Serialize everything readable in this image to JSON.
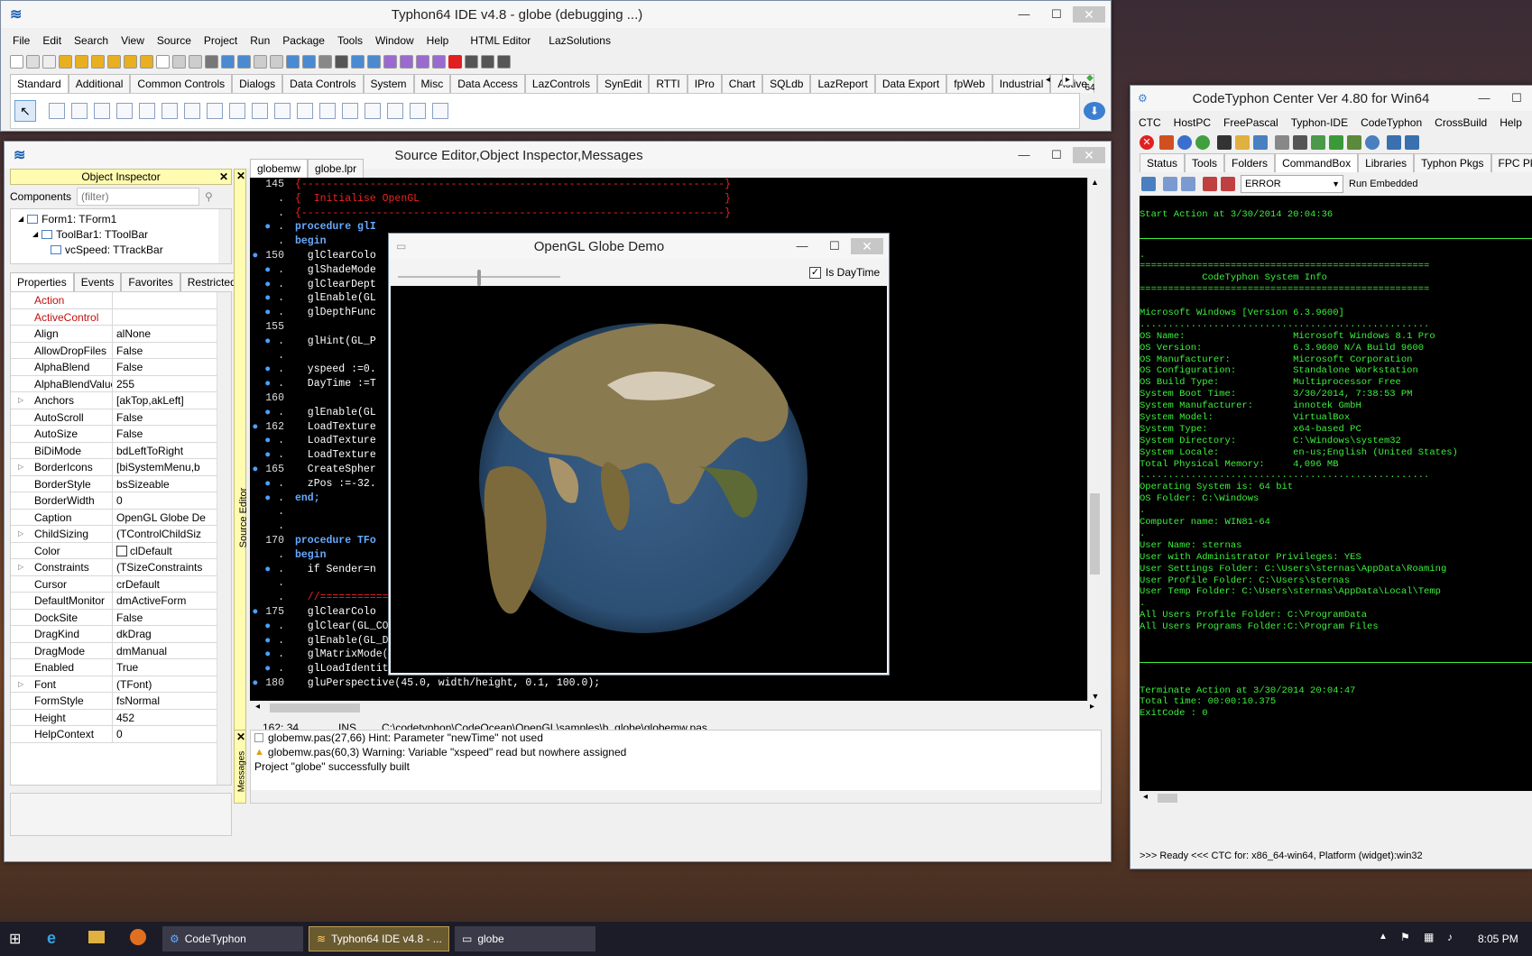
{
  "ide_main": {
    "title": "Typhon64 IDE v4.8 - globe (debugging ...)",
    "menu": [
      "File",
      "Edit",
      "Search",
      "View",
      "Source",
      "Project",
      "Run",
      "Package",
      "Tools",
      "Window",
      "Help",
      "HTML Editor",
      "LazSolutions"
    ],
    "palette_tabs": [
      "Standard",
      "Additional",
      "Common Controls",
      "Dialogs",
      "Data Controls",
      "System",
      "Misc",
      "Data Access",
      "LazControls",
      "SynEdit",
      "RTTI",
      "IPro",
      "Chart",
      "SQLdb",
      "LazReport",
      "Data Export",
      "fpWeb",
      "Industrial",
      "Active"
    ],
    "bitness": "64"
  },
  "source_window": {
    "title": "Source Editor,Object Inspector,Messages"
  },
  "object_inspector": {
    "title": "Object Inspector",
    "components_label": "Components",
    "filter_placeholder": "(filter)",
    "tree": [
      "Form1: TForm1",
      "ToolBar1: TToolBar",
      "vcSpeed: TTrackBar"
    ],
    "tabs": [
      "Properties",
      "Events",
      "Favorites",
      "Restricted"
    ],
    "props": [
      {
        "name": "Action",
        "value": "",
        "style": "red"
      },
      {
        "name": "ActiveControl",
        "value": "",
        "style": "red"
      },
      {
        "name": "Align",
        "value": "alNone"
      },
      {
        "name": "AllowDropFiles",
        "value": "False"
      },
      {
        "name": "AlphaBlend",
        "value": "False"
      },
      {
        "name": "AlphaBlendValue",
        "value": "255"
      },
      {
        "name": "Anchors",
        "value": "[akTop,akLeft]",
        "expand": true
      },
      {
        "name": "AutoScroll",
        "value": "False"
      },
      {
        "name": "AutoSize",
        "value": "False"
      },
      {
        "name": "BiDiMode",
        "value": "bdLeftToRight"
      },
      {
        "name": "BorderIcons",
        "value": "[biSystemMenu,b",
        "expand": true
      },
      {
        "name": "BorderStyle",
        "value": "bsSizeable"
      },
      {
        "name": "BorderWidth",
        "value": "0"
      },
      {
        "name": "Caption",
        "value": "OpenGL Globe De"
      },
      {
        "name": "ChildSizing",
        "value": "(TControlChildSiz",
        "expand": true
      },
      {
        "name": "Color",
        "value": "clDefault",
        "swatch": true
      },
      {
        "name": "Constraints",
        "value": "(TSizeConstraints",
        "expand": true
      },
      {
        "name": "Cursor",
        "value": "crDefault"
      },
      {
        "name": "DefaultMonitor",
        "value": "dmActiveForm"
      },
      {
        "name": "DockSite",
        "value": "False"
      },
      {
        "name": "DragKind",
        "value": "dkDrag"
      },
      {
        "name": "DragMode",
        "value": "dmManual"
      },
      {
        "name": "Enabled",
        "value": "True"
      },
      {
        "name": "Font",
        "value": "(TFont)",
        "expand": true
      },
      {
        "name": "FormStyle",
        "value": "fsNormal"
      },
      {
        "name": "Height",
        "value": "452"
      },
      {
        "name": "HelpContext",
        "value": "0"
      }
    ]
  },
  "editor": {
    "tabs": [
      "globemw",
      "globe.lpr"
    ],
    "side_label": "Source Editor",
    "lines": [
      {
        "n": "145",
        "dot": false,
        "text": "{--------------------------------------------------------------------}",
        "c": "#e22"
      },
      {
        "n": ".",
        "dot": false,
        "text": "{  Initialise OpenGL                                                 }",
        "c": "#e22"
      },
      {
        "n": ".",
        "dot": false,
        "text": "{--------------------------------------------------------------------}",
        "c": "#e22"
      },
      {
        "n": ".",
        "dot": true,
        "text": "procedure glI",
        "c": "#6af",
        "bold": true
      },
      {
        "n": ".",
        "dot": false,
        "text": "begin",
        "c": "#6af",
        "bold": true
      },
      {
        "n": "150",
        "dot": true,
        "text": "  glClearColo",
        "c": "#fff"
      },
      {
        "n": ".",
        "dot": true,
        "text": "  glShadeMode",
        "c": "#fff"
      },
      {
        "n": ".",
        "dot": true,
        "text": "  glClearDept",
        "c": "#fff"
      },
      {
        "n": ".",
        "dot": true,
        "text": "  glEnable(GL",
        "c": "#fff"
      },
      {
        "n": ".",
        "dot": true,
        "text": "  glDepthFunc",
        "c": "#fff"
      },
      {
        "n": "155",
        "dot": false,
        "text": "",
        "c": "#fff"
      },
      {
        "n": ".",
        "dot": true,
        "text": "  glHint(GL_P",
        "c": "#fff"
      },
      {
        "n": ".",
        "dot": false,
        "text": "",
        "c": "#fff"
      },
      {
        "n": ".",
        "dot": true,
        "text": "  yspeed :=0.",
        "c": "#fff"
      },
      {
        "n": ".",
        "dot": true,
        "text": "  DayTime :=T",
        "c": "#fff"
      },
      {
        "n": "160",
        "dot": false,
        "text": "",
        "c": "#fff"
      },
      {
        "n": ".",
        "dot": true,
        "text": "  glEnable(GL",
        "c": "#fff"
      },
      {
        "n": "162",
        "dot": true,
        "text": "  LoadTexture",
        "c": "#fff"
      },
      {
        "n": ".",
        "dot": true,
        "text": "  LoadTexture",
        "c": "#fff"
      },
      {
        "n": ".",
        "dot": true,
        "text": "  LoadTexture",
        "c": "#fff"
      },
      {
        "n": "165",
        "dot": true,
        "text": "  CreateSpher",
        "c": "#fff"
      },
      {
        "n": ".",
        "dot": true,
        "text": "  zPos :=-32.",
        "c": "#fff"
      },
      {
        "n": ".",
        "dot": true,
        "text": "end;",
        "c": "#6af",
        "bold": true
      },
      {
        "n": ".",
        "dot": false,
        "text": "",
        "c": "#fff"
      },
      {
        "n": ".",
        "dot": false,
        "text": "",
        "c": "#fff"
      },
      {
        "n": "170",
        "dot": false,
        "text": "procedure TFo",
        "c": "#6af",
        "bold": true
      },
      {
        "n": ".",
        "dot": false,
        "text": "begin",
        "c": "#6af",
        "bold": true
      },
      {
        "n": ".",
        "dot": true,
        "text": "  if Sender=n",
        "c": "#fff"
      },
      {
        "n": ".",
        "dot": false,
        "text": "",
        "c": "#fff"
      },
      {
        "n": ".",
        "dot": false,
        "text": "  //===========                                                                    =========",
        "c": "#e22"
      },
      {
        "n": "175",
        "dot": true,
        "text": "  glClearColo                                                                    cene",
        "c": "#fff"
      },
      {
        "n": ".",
        "dot": true,
        "text": "  glClear(GL_COLOR_BUFFER_BIT or GL_DEPTH_BUFFER_BIT);   // Clear the colour buffer",
        "c": "#fff"
      },
      {
        "n": ".",
        "dot": true,
        "text": "  glEnable(GL_DEPTH_TEST);",
        "c": "#fff"
      },
      {
        "n": ".",
        "dot": true,
        "text": "  glMatrixMode(GL_PROJECTION);",
        "c": "#fff"
      },
      {
        "n": ".",
        "dot": true,
        "text": "  glLoadIdentity();                              // Load a \"clean\" model matrix on the stack",
        "c": "#fff"
      },
      {
        "n": "180",
        "dot": true,
        "text": "  gluPerspective(45.0, width/height, 0.1, 100.0);",
        "c": "#fff"
      }
    ],
    "status": {
      "pos": "162: 34",
      "mode": "INS",
      "file": "C:\\codetyphon\\CodeOcean\\OpenGL\\samples\\b_globe\\globemw.pas"
    }
  },
  "messages": {
    "side_label": "Messages",
    "items": [
      {
        "text": "globemw.pas(27,66) Hint: Parameter \"newTime\" not used",
        "kind": "hint"
      },
      {
        "text": "globemw.pas(60,3) Warning: Variable \"xspeed\" read but nowhere assigned",
        "kind": "warn"
      },
      {
        "text": "Project \"globe\" successfully built",
        "kind": "info"
      }
    ]
  },
  "globe_window": {
    "title": "OpenGL Globe Demo",
    "checkbox_label": "Is DayTime",
    "checked": true,
    "slider_value": 0.5
  },
  "ctc": {
    "title": "CodeTyphon Center Ver 4.80 for Win64",
    "menu": [
      "CTC",
      "HostPC",
      "FreePascal",
      "Typhon-IDE",
      "CodeTyphon",
      "CrossBuild",
      "Help"
    ],
    "tabs": [
      "Status",
      "Tools",
      "Folders",
      "CommandBox",
      "Libraries",
      "Typhon Pkgs",
      "FPC Pkgs"
    ],
    "level": "ERROR",
    "run_label": "Run Embedded",
    "console": [
      "",
      "Start Action at 3/30/2014 20:04:36",
      "",
      "---",
      ".",
      "===================================================",
      "           CodeTyphon System Info",
      "===================================================",
      "",
      "Microsoft Windows [Version 6.3.9600]",
      "...................................................",
      "OS Name:                   Microsoft Windows 8.1 Pro",
      "OS Version:                6.3.9600 N/A Build 9600",
      "OS Manufacturer:           Microsoft Corporation",
      "OS Configuration:          Standalone Workstation",
      "OS Build Type:             Multiprocessor Free",
      "System Boot Time:          3/30/2014, 7:38:53 PM",
      "System Manufacturer:       innotek GmbH",
      "System Model:              VirtualBox",
      "System Type:               x64-based PC",
      "System Directory:          C:\\Windows\\system32",
      "System Locale:             en-us;English (United States)",
      "Total Physical Memory:     4,096 MB",
      "...................................................",
      "Operating System is: 64 bit",
      "OS Folder: C:\\Windows",
      ".",
      "Computer name: WIN81-64",
      ".",
      "User Name: sternas",
      "User with Administrator Privileges: YES",
      "User Settings Folder: C:\\Users\\sternas\\AppData\\Roaming",
      "User Profile Folder: C:\\Users\\sternas",
      "User Temp Folder: C:\\Users\\sternas\\AppData\\Local\\Temp",
      ".",
      "All Users Profile Folder: C:\\ProgramData",
      "All Users Programs Folder:C:\\Program Files",
      "",
      "",
      "---",
      "",
      "Terminate Action at 3/30/2014 20:04:47",
      "Total time: 00:00:10.375",
      "ExitCode : 0"
    ],
    "status": ">>> Ready <<<  CTC for: x86_64-win64, Platform (widget):win32"
  },
  "taskbar": {
    "items": [
      "CodeTyphon",
      "Typhon64 IDE v4.8 - ...",
      "globe"
    ],
    "time": "8:05 PM"
  },
  "colors": {
    "console_green": "#3cf03c",
    "taskbar": "#1a1a2e",
    "accent": "#316ac5"
  }
}
